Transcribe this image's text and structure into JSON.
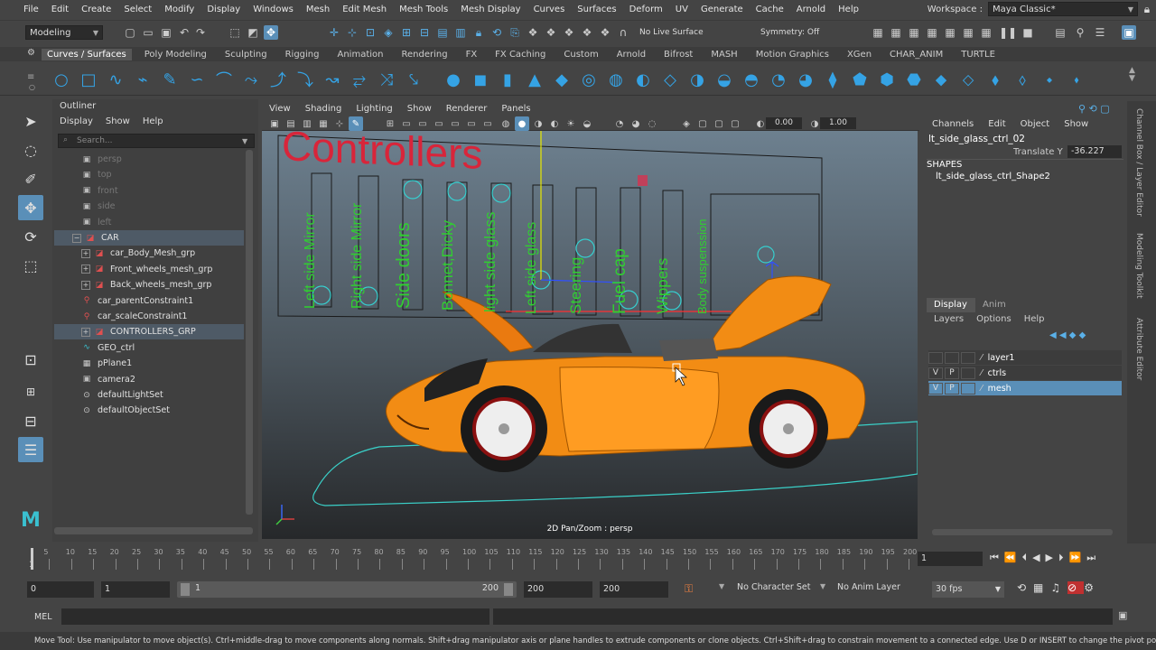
{
  "menubar": [
    "File",
    "Edit",
    "Create",
    "Select",
    "Modify",
    "Display",
    "Windows",
    "Mesh",
    "Edit Mesh",
    "Mesh Tools",
    "Mesh Display",
    "Curves",
    "Surfaces",
    "Deform",
    "UV",
    "Generate",
    "Cache",
    "Arnold",
    "Help"
  ],
  "workspace": {
    "label": "Workspace :",
    "value": "Maya Classic*"
  },
  "status": {
    "mode": "Modeling",
    "live_surface": "No Live Surface",
    "symmetry": "Symmetry: Off"
  },
  "shelf_tabs": [
    "Curves / Surfaces",
    "Poly Modeling",
    "Sculpting",
    "Rigging",
    "Animation",
    "Rendering",
    "FX",
    "FX Caching",
    "Custom",
    "Arnold",
    "Bifrost",
    "MASH",
    "Motion Graphics",
    "XGen",
    "CHAR_ANIM",
    "TURTLE"
  ],
  "outliner": {
    "title": "Outliner",
    "menu": [
      "Display",
      "Show",
      "Help"
    ],
    "search_placeholder": "Search...",
    "rows": [
      {
        "label": "persp",
        "icon": "camera-icon",
        "dim": true
      },
      {
        "label": "top",
        "icon": "camera-icon",
        "dim": true
      },
      {
        "label": "front",
        "icon": "camera-icon",
        "dim": true
      },
      {
        "label": "side",
        "icon": "camera-icon",
        "dim": true
      },
      {
        "label": "left",
        "icon": "camera-icon",
        "dim": true
      },
      {
        "label": "CAR",
        "icon": "group-icon"
      },
      {
        "label": "car_Body_Mesh_grp",
        "icon": "group-icon"
      },
      {
        "label": "Front_wheels_mesh_grp",
        "icon": "group-icon"
      },
      {
        "label": "Back_wheels_mesh_grp",
        "icon": "group-icon"
      },
      {
        "label": "car_parentConstraint1",
        "icon": "constraint-icon"
      },
      {
        "label": "car_scaleConstraint1",
        "icon": "constraint-icon"
      },
      {
        "label": "CONTROLLERS_GRP",
        "icon": "group-icon"
      },
      {
        "label": "GEO_ctrl",
        "icon": "curve-icon"
      },
      {
        "label": "pPlane1",
        "icon": "mesh-icon"
      },
      {
        "label": "camera2",
        "icon": "camera-icon"
      },
      {
        "label": "defaultLightSet",
        "icon": "set-icon"
      },
      {
        "label": "defaultObjectSet",
        "icon": "set-icon"
      }
    ]
  },
  "viewport": {
    "menu": [
      "View",
      "Shading",
      "Lighting",
      "Show",
      "Renderer",
      "Panels"
    ],
    "exposure": "0.00",
    "gamma": "1.00",
    "label": "2D Pan/Zoom : persp",
    "board_title": "Controllers",
    "controller_labels": [
      "Left side Mirror",
      "Right side Mirror",
      "Side doors",
      "Bonnet,Dicky",
      "light side glass",
      "Left side glass",
      "Steering",
      "Fuel cap",
      "Wippers",
      "Body suspenssion"
    ]
  },
  "channel_box": {
    "menu": [
      "Channels",
      "Edit",
      "Object",
      "Show"
    ],
    "object": "lt_side_glass_ctrl_02",
    "attr_label": "Translate Y",
    "attr_value": "-36.227",
    "shapes_label": "SHAPES",
    "shape_name": "lt_side_glass_ctrl_Shape2"
  },
  "layer_editor": {
    "tabs": [
      "Display",
      "Anim"
    ],
    "menu": [
      "Layers",
      "Options",
      "Help"
    ],
    "layers": [
      {
        "v": "",
        "p": "",
        "name": "layer1"
      },
      {
        "v": "V",
        "p": "P",
        "name": "ctrls"
      },
      {
        "v": "V",
        "p": "P",
        "name": "mesh"
      }
    ]
  },
  "side_tabs": [
    "Channel Box / Layer Editor",
    "Modeling Toolkit",
    "Attribute Editor"
  ],
  "timeslider": {
    "ticks": [
      "5",
      "10",
      "15",
      "20",
      "25",
      "30",
      "35",
      "40",
      "45",
      "50",
      "55",
      "60",
      "65",
      "70",
      "75",
      "80",
      "85",
      "90",
      "95",
      "100",
      "105",
      "110",
      "115",
      "120",
      "125",
      "130",
      "135",
      "140",
      "145",
      "150",
      "155",
      "160",
      "165",
      "170",
      "175",
      "180",
      "185",
      "190",
      "195",
      "200"
    ],
    "start_tick": "1",
    "current_frame": "1"
  },
  "range": {
    "start": "0",
    "inner_start": "1",
    "slider_start": "1",
    "slider_end": "200",
    "inner_end": "200",
    "end": "200",
    "char_set": "No Character Set",
    "anim_layer": "No Anim Layer",
    "fps": "30 fps"
  },
  "cmdline": {
    "label": "MEL"
  },
  "helpline": "Move Tool: Use manipulator to move object(s). Ctrl+middle-drag to move components along normals. Shift+drag manipulator axis or plane handles to extrude components or clone objects. Ctrl+Shift+drag to constrain movement to a connected edge. Use D or INSERT to change the pivot position and axis orientation."
}
